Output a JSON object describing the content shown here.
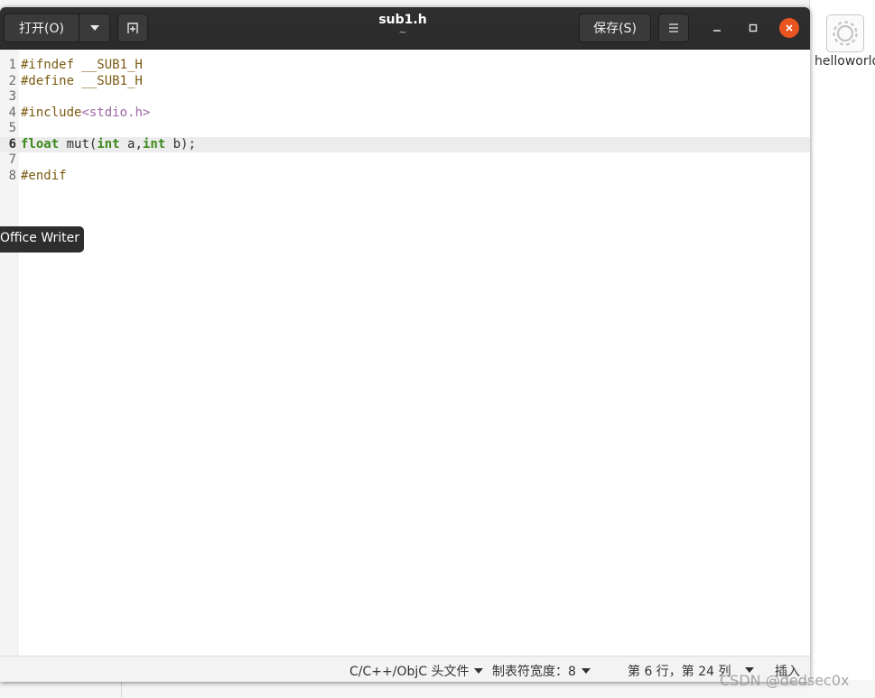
{
  "window": {
    "title": "sub1.h",
    "subtitle": "~"
  },
  "headerbar": {
    "open_label": "打开(O)",
    "open_dropdown_icon": "caret-down-icon",
    "new_tab_icon": "new-document-icon",
    "save_label": "保存(S)",
    "menu_icon": "hamburger-menu-icon",
    "minimize_icon": "minimize-icon",
    "maximize_icon": "maximize-icon",
    "close_icon": "close-icon",
    "close_color": "#e95420"
  },
  "editor": {
    "current_line": 6,
    "lines": [
      {
        "number": "1",
        "tokens": [
          {
            "t": "#ifndef __SUB1_H",
            "c": "pre"
          }
        ]
      },
      {
        "number": "2",
        "tokens": [
          {
            "t": "#define __SUB1_H",
            "c": "pre"
          }
        ]
      },
      {
        "number": "3",
        "tokens": []
      },
      {
        "number": "4",
        "tokens": [
          {
            "t": "#include",
            "c": "pre"
          },
          {
            "t": "<stdio.h>",
            "c": "str"
          }
        ]
      },
      {
        "number": "5",
        "tokens": []
      },
      {
        "number": "6",
        "tokens": [
          {
            "t": "float",
            "c": "kw"
          },
          {
            "t": " mut(",
            "c": "plain"
          },
          {
            "t": "int",
            "c": "kw"
          },
          {
            "t": " a,",
            "c": "plain"
          },
          {
            "t": "int",
            "c": "kw"
          },
          {
            "t": " b);",
            "c": "plain"
          }
        ]
      },
      {
        "number": "7",
        "tokens": []
      },
      {
        "number": "8",
        "tokens": [
          {
            "t": "#endif",
            "c": "pre"
          }
        ]
      }
    ]
  },
  "tooltip": {
    "text": "Office Writer"
  },
  "statusbar": {
    "language": "C/C++/ObjC 头文件",
    "tab_width": "制表符宽度：8",
    "position": "第 6 行，第 24 列",
    "insert_mode": "插入"
  },
  "desktop": {
    "file_label": "helloworld",
    "file_icon": "gear-document-icon"
  },
  "watermark": "CSDN @dedsec0x"
}
